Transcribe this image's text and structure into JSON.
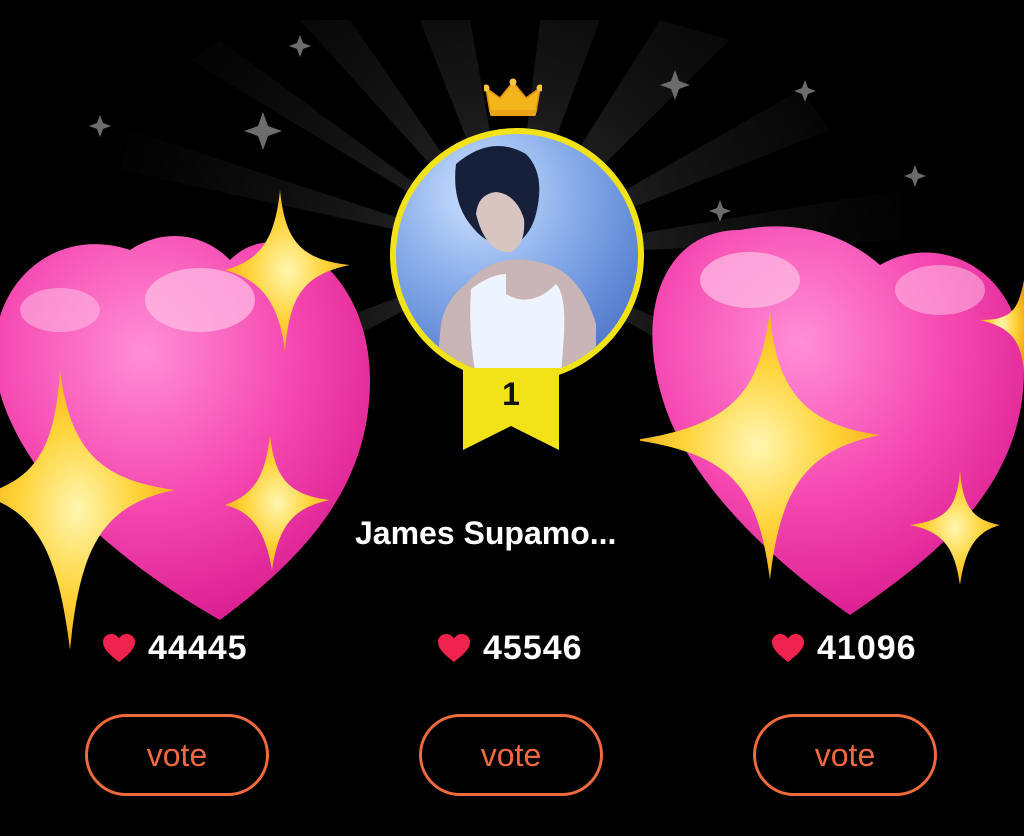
{
  "leaderboard": {
    "center": {
      "rank": "1",
      "name": "James Supamo...",
      "likes": "45546",
      "vote_label": "vote"
    },
    "left": {
      "name_fragment": "...",
      "likes": "44445",
      "vote_label": "vote"
    },
    "right": {
      "name_fragment": "",
      "likes": "41096",
      "vote_label": "vote"
    }
  },
  "colors": {
    "background": "#000000",
    "accent": "#f06a3d",
    "gold": "#f1e318",
    "heart_red": "#f0224e",
    "pink_heart": "#ff4fb8",
    "sparkle": "#ffd43a"
  },
  "icons": {
    "crown": "crown-icon",
    "like": "heart-icon",
    "sticker_heart": "pink-heart-sticker",
    "sticker_sparkle": "sparkle-icon"
  }
}
